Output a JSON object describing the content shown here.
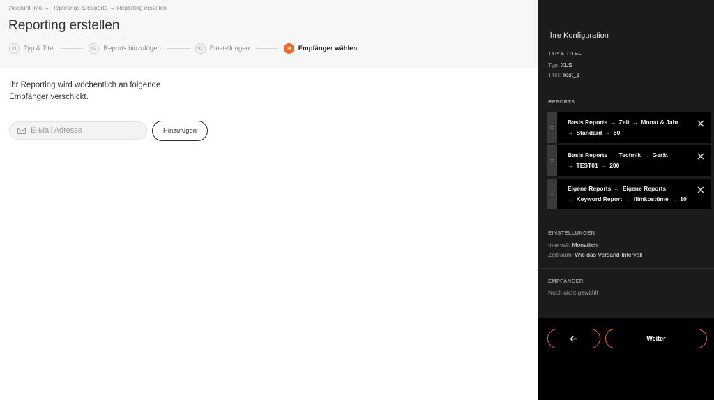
{
  "breadcrumb": {
    "items": [
      "Account Info",
      "Reportings & Exporte",
      "Reporting erstellen"
    ],
    "separator": "→"
  },
  "page_title": "Reporting erstellen",
  "steps": [
    {
      "num": "01",
      "label": "Typ & Titel",
      "active": false
    },
    {
      "num": "02",
      "label": "Reports hinzufügen",
      "active": false
    },
    {
      "num": "03",
      "label": "Einstellungen",
      "active": false
    },
    {
      "num": "04",
      "label": "Empfänger wählen",
      "active": true
    }
  ],
  "info_text": "Ihr Reporting wird wöchentlich an folgende Empfänger verschickt.",
  "email": {
    "placeholder": "E-Mail Adresse",
    "value": ""
  },
  "add_button": "Hinzufügen",
  "sidebar": {
    "title": "Ihre Konfiguration",
    "typ_titel": {
      "heading": "Typ & Titel",
      "typ_label": "Typ:",
      "typ_value": "XLS",
      "titel_label": "Titel:",
      "titel_value": "Test_1"
    },
    "reports": {
      "heading": "Reports",
      "items": [
        {
          "line1": [
            "Basis Reports",
            "Zeit",
            "Monat & Jahr"
          ],
          "line2": [
            "Standard",
            "50"
          ]
        },
        {
          "line1": [
            "Basis Reports",
            "Technik",
            "Gerät"
          ],
          "line2": [
            "TEST01",
            "200"
          ]
        },
        {
          "line1": [
            "Eigene Reports",
            "Eigene Reports"
          ],
          "line2": [
            "Keyword Report",
            "filmkostüme",
            "10"
          ]
        }
      ]
    },
    "einstellungen": {
      "heading": "Einstellungen",
      "intervall_label": "Intervall:",
      "intervall_value": "Monatlich",
      "zeitraum_label": "Zeitraum:",
      "zeitraum_value": "Wie das Versand-Intervall"
    },
    "empfaenger": {
      "heading": "Empfänger",
      "value": "Noch nicht gewählt"
    },
    "next_button": "Weiter"
  },
  "colors": {
    "accent": "#f26522",
    "sidebar_bg": "#1b1b1b",
    "header_bg": "#f7f7f7"
  },
  "icons": [
    "mail-icon",
    "close-icon",
    "drag-handle-icon",
    "arrow-left-icon"
  ]
}
